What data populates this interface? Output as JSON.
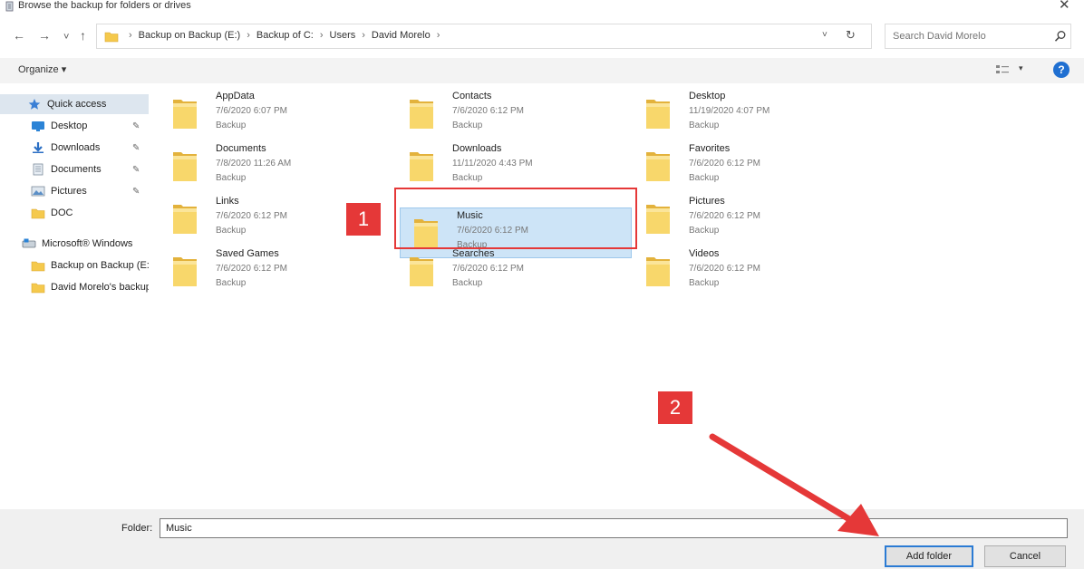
{
  "window": {
    "title": "Browse the backup for folders or drives",
    "close_glyph": "✕"
  },
  "nav": {
    "back_glyph": "←",
    "forward_glyph": "→",
    "recent_glyph": "˅",
    "up_glyph": "↑",
    "breadcrumbs": [
      "Backup on Backup (E:)",
      "Backup of C:",
      "Users",
      "David Morelo"
    ],
    "separator": "›",
    "dropdown_glyph": "˅",
    "refresh_glyph": "↻",
    "search_placeholder": "Search David Morelo"
  },
  "toolbar": {
    "organize_label": "Organize ▾",
    "view_dropdown_glyph": "▾",
    "help_glyph": "?"
  },
  "sidebar": {
    "items": [
      {
        "label": "Quick access",
        "icon": "star-icon",
        "active": true
      },
      {
        "label": "Desktop",
        "icon": "desktop-icon",
        "pinned": true
      },
      {
        "label": "Downloads",
        "icon": "download-icon",
        "pinned": true
      },
      {
        "label": "Documents",
        "icon": "documents-icon",
        "pinned": true
      },
      {
        "label": "Pictures",
        "icon": "pictures-icon",
        "pinned": true
      },
      {
        "label": "DOC",
        "icon": "folder-icon"
      },
      {
        "label": "Microsoft® Windows",
        "icon": "drive-icon"
      },
      {
        "label": "Backup on Backup (E:)",
        "icon": "folder-icon"
      },
      {
        "label": "David Morelo's backup",
        "icon": "folder-icon"
      }
    ]
  },
  "folders": [
    {
      "name": "AppData",
      "date": "7/6/2020 6:07 PM",
      "location": "Backup"
    },
    {
      "name": "Contacts",
      "date": "7/6/2020 6:12 PM",
      "location": "Backup"
    },
    {
      "name": "Desktop",
      "date": "11/19/2020 4:07 PM",
      "location": "Backup"
    },
    {
      "name": "Documents",
      "date": "7/8/2020 11:26 AM",
      "location": "Backup"
    },
    {
      "name": "Downloads",
      "date": "11/11/2020 4:43 PM",
      "location": "Backup"
    },
    {
      "name": "Favorites",
      "date": "7/6/2020 6:12 PM",
      "location": "Backup"
    },
    {
      "name": "Links",
      "date": "7/6/2020 6:12 PM",
      "location": "Backup"
    },
    {
      "name": "Music",
      "date": "7/6/2020 6:12 PM",
      "location": "Backup",
      "selected": true
    },
    {
      "name": "Pictures",
      "date": "7/6/2020 6:12 PM",
      "location": "Backup"
    },
    {
      "name": "Saved Games",
      "date": "7/6/2020 6:12 PM",
      "location": "Backup"
    },
    {
      "name": "Searches",
      "date": "7/6/2020 6:12 PM",
      "location": "Backup"
    },
    {
      "name": "Videos",
      "date": "7/6/2020 6:12 PM",
      "location": "Backup"
    }
  ],
  "callouts": {
    "one": "1",
    "two": "2"
  },
  "footer": {
    "folder_label": "Folder:",
    "folder_value": "Music",
    "add_button": "Add folder",
    "cancel_button": "Cancel"
  },
  "colors": {
    "accent_red": "#e53838",
    "folder_yellow": "#f5c94c",
    "selection": "#cde4f7",
    "primary_border": "#2b7bd4"
  }
}
